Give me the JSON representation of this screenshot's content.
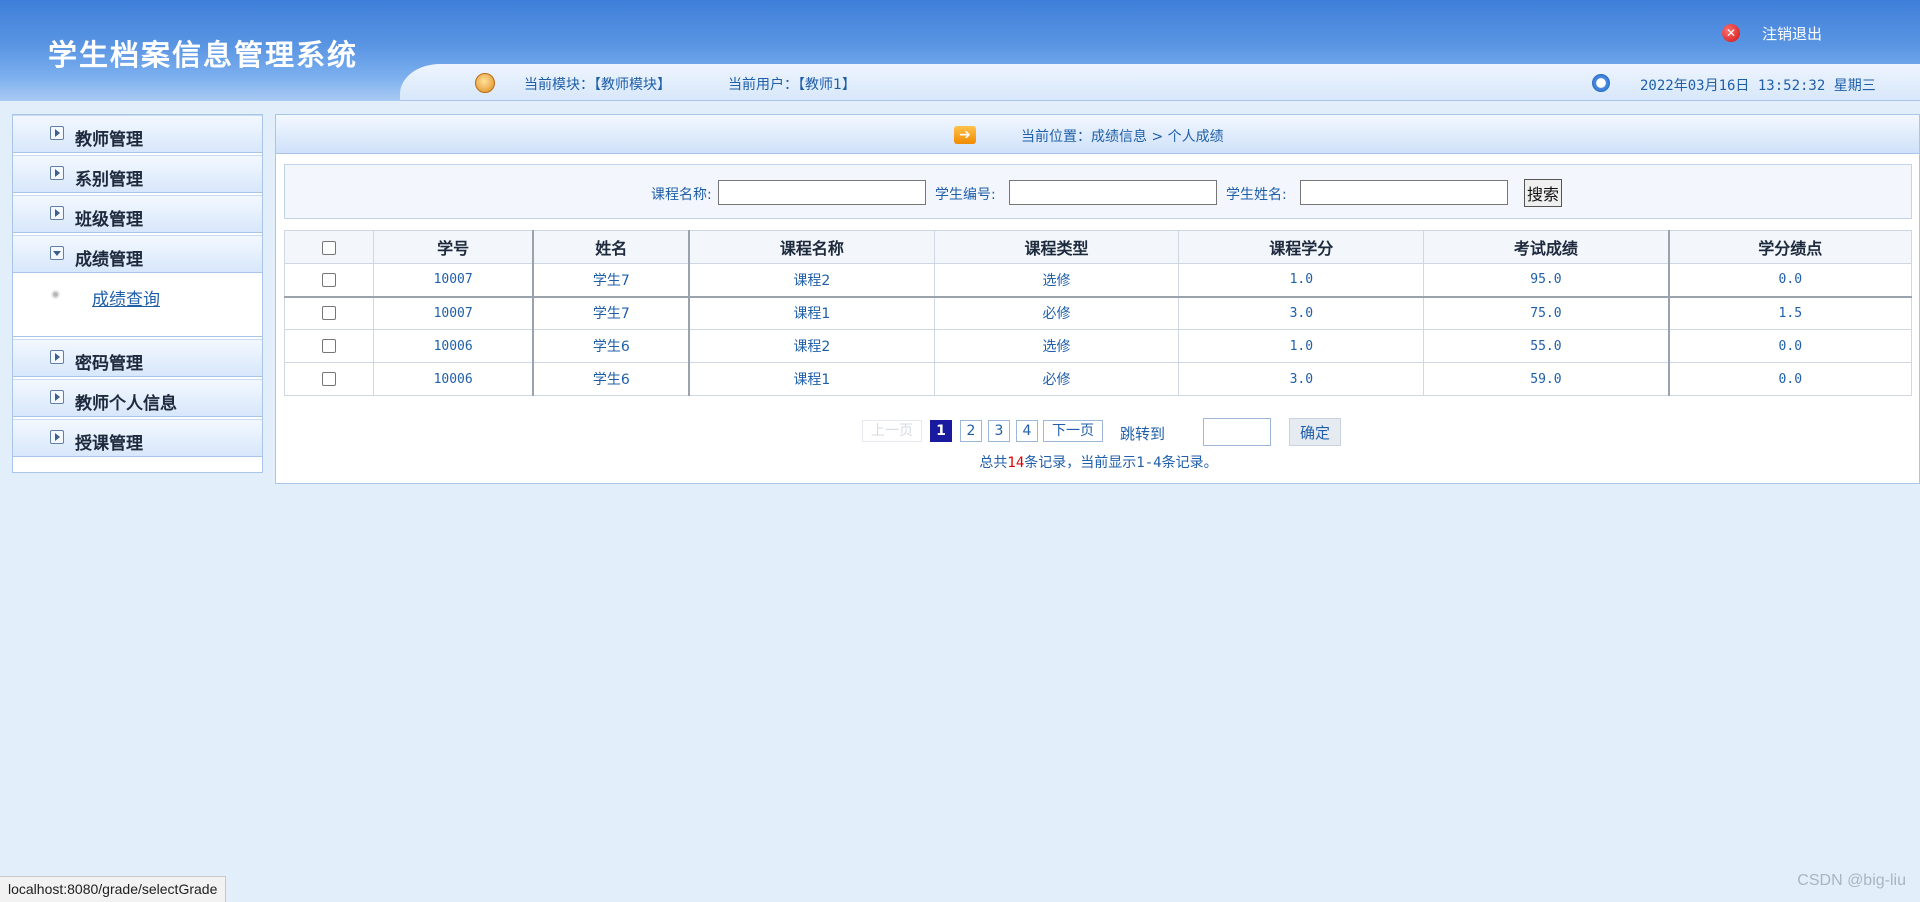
{
  "header": {
    "title": "学生档案信息管理系统",
    "logout_label": "注销退出",
    "module_text": "当前模块：【教师模块】",
    "user_text": "当前用户：【教师1】",
    "datetime": "2022年03月16日 13:52:32 星期三"
  },
  "sidebar": {
    "items": [
      {
        "label": "教师管理"
      },
      {
        "label": "系别管理"
      },
      {
        "label": "班级管理"
      },
      {
        "label": "成绩管理",
        "open": true,
        "children": [
          {
            "label": "成绩查询"
          }
        ]
      },
      {
        "label": "密码管理"
      },
      {
        "label": "教师个人信息"
      },
      {
        "label": "授课管理"
      }
    ]
  },
  "breadcrumb": {
    "text": "当前位置：成绩信息 > 个人成绩"
  },
  "search": {
    "course_label": "课程名称:",
    "course_value": "",
    "student_no_label": "学生编号:",
    "student_no_value": "",
    "student_name_label": "学生姓名:",
    "student_name_value": "",
    "button_label": "搜索"
  },
  "table": {
    "headers": [
      "学号",
      "姓名",
      "课程名称",
      "课程类型",
      "课程学分",
      "考试成绩",
      "学分绩点"
    ],
    "rows": [
      {
        "no": "10007",
        "name": "学生7",
        "course": "课程2",
        "type": "选修",
        "credit": "1.0",
        "score": "95.0",
        "gpa": "0.0"
      },
      {
        "no": "10007",
        "name": "学生7",
        "course": "课程1",
        "type": "必修",
        "credit": "3.0",
        "score": "75.0",
        "gpa": "1.5"
      },
      {
        "no": "10006",
        "name": "学生6",
        "course": "课程2",
        "type": "选修",
        "credit": "1.0",
        "score": "55.0",
        "gpa": "0.0"
      },
      {
        "no": "10006",
        "name": "学生6",
        "course": "课程1",
        "type": "必修",
        "credit": "3.0",
        "score": "59.0",
        "gpa": "0.0"
      }
    ]
  },
  "pager": {
    "prev_label": "上一页",
    "pages": [
      "1",
      "2",
      "3",
      "4"
    ],
    "current_page": "1",
    "next_label": "下一页",
    "jump_label": "跳转到",
    "jump_value": "",
    "ok_label": "确定",
    "summary_prefix": "总共",
    "summary_count": "14",
    "summary_suffix": "条记录，当前显示1-4条记录。"
  },
  "statusbar": {
    "url": "localhost:8080/grade/selectGrade"
  },
  "watermark": "CSDN @big-liu",
  "colors": {
    "header_blue": "#3f7fd9",
    "link_blue": "#1f5fa9",
    "page_bg": "#e3eefb",
    "active_page": "#1a1aa0",
    "summary_red": "#e00000"
  }
}
